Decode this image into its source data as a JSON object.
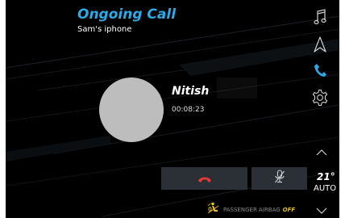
{
  "call": {
    "title": "Ongoing Call",
    "device": "Sam's iphone"
  },
  "contact": {
    "name": "Nitish",
    "duration": "00:08:23",
    "avatar_color": "#bdbdbd"
  },
  "controls": {
    "end_call_icon": "phone-hangup-icon",
    "mute_icon": "microphone-muted-icon"
  },
  "sidebar": {
    "items": [
      {
        "icon": "music-note-icon",
        "active": false
      },
      {
        "icon": "navigation-icon",
        "active": false
      },
      {
        "icon": "phone-icon",
        "active": true
      },
      {
        "icon": "settings-gear-icon",
        "active": false
      }
    ]
  },
  "climate": {
    "temperature": "21°",
    "mode": "AUTO",
    "up_icon": "chevron-up-icon",
    "down_icon": "chevron-down-icon"
  },
  "status": {
    "airbag_label": "PASSENGER AIRBAG",
    "airbag_state": "OFF",
    "airbag_icon": "passenger-airbag-off-icon"
  },
  "colors": {
    "accent": "#2fa8e6",
    "hangup": "#e53935",
    "warning": "#e8c21a",
    "button_bg": "#2b3037"
  }
}
